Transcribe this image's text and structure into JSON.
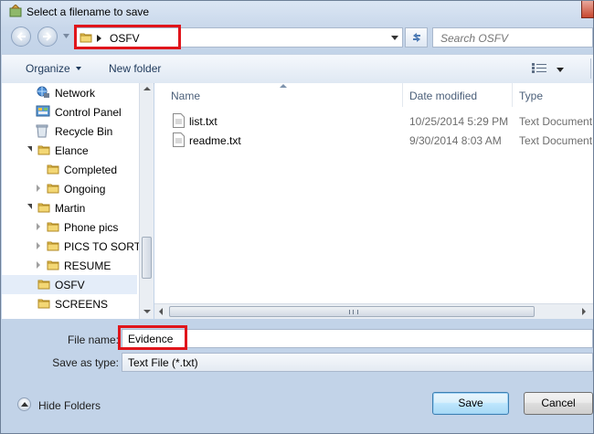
{
  "window": {
    "title": "Select a filename to save"
  },
  "address": {
    "path": "OSFV"
  },
  "search": {
    "placeholder": "Search OSFV"
  },
  "toolbar": {
    "organize_label": "Organize",
    "new_folder_label": "New folder"
  },
  "nav_pane": {
    "items": [
      {
        "label": "Network",
        "icon": "network-icon",
        "level": 0,
        "expander": "none"
      },
      {
        "label": "Control Panel",
        "icon": "control-panel-icon",
        "level": 0,
        "expander": "none"
      },
      {
        "label": "Recycle Bin",
        "icon": "recycle-bin-icon",
        "level": 0,
        "expander": "none"
      },
      {
        "label": "Elance",
        "icon": "folder-icon",
        "level": 0,
        "expander": "open"
      },
      {
        "label": "Completed",
        "icon": "folder-icon",
        "level": 1,
        "expander": "none"
      },
      {
        "label": "Ongoing",
        "icon": "folder-icon",
        "level": 1,
        "expander": "closed"
      },
      {
        "label": "Martin",
        "icon": "folder-icon",
        "level": 0,
        "expander": "open"
      },
      {
        "label": "Phone pics",
        "icon": "folder-icon",
        "level": 1,
        "expander": "closed"
      },
      {
        "label": "PICS TO SORT",
        "icon": "folder-icon",
        "level": 1,
        "expander": "closed"
      },
      {
        "label": "RESUME",
        "icon": "folder-icon",
        "level": 1,
        "expander": "closed"
      },
      {
        "label": "OSFV",
        "icon": "folder-icon",
        "level": 0,
        "expander": "none",
        "selected": true
      },
      {
        "label": "SCREENS",
        "icon": "folder-icon",
        "level": 0,
        "expander": "none"
      }
    ]
  },
  "file_list": {
    "columns": [
      "Name",
      "Date modified",
      "Type"
    ],
    "rows": [
      {
        "name": "list.txt",
        "date": "10/25/2014 5:29 PM",
        "type": "Text Document"
      },
      {
        "name": "readme.txt",
        "date": "9/30/2014 8:03 AM",
        "type": "Text Document"
      }
    ]
  },
  "form": {
    "filename_label": "File name:",
    "filename_value": "Evidence",
    "type_label": "Save as type:",
    "type_value": "Text File (*.txt)"
  },
  "footer": {
    "hide_folders_label": "Hide Folders",
    "save_label": "Save",
    "cancel_label": "Cancel"
  },
  "colors": {
    "highlight_box": "#e0151b",
    "selected_row": "#e4edf9"
  }
}
